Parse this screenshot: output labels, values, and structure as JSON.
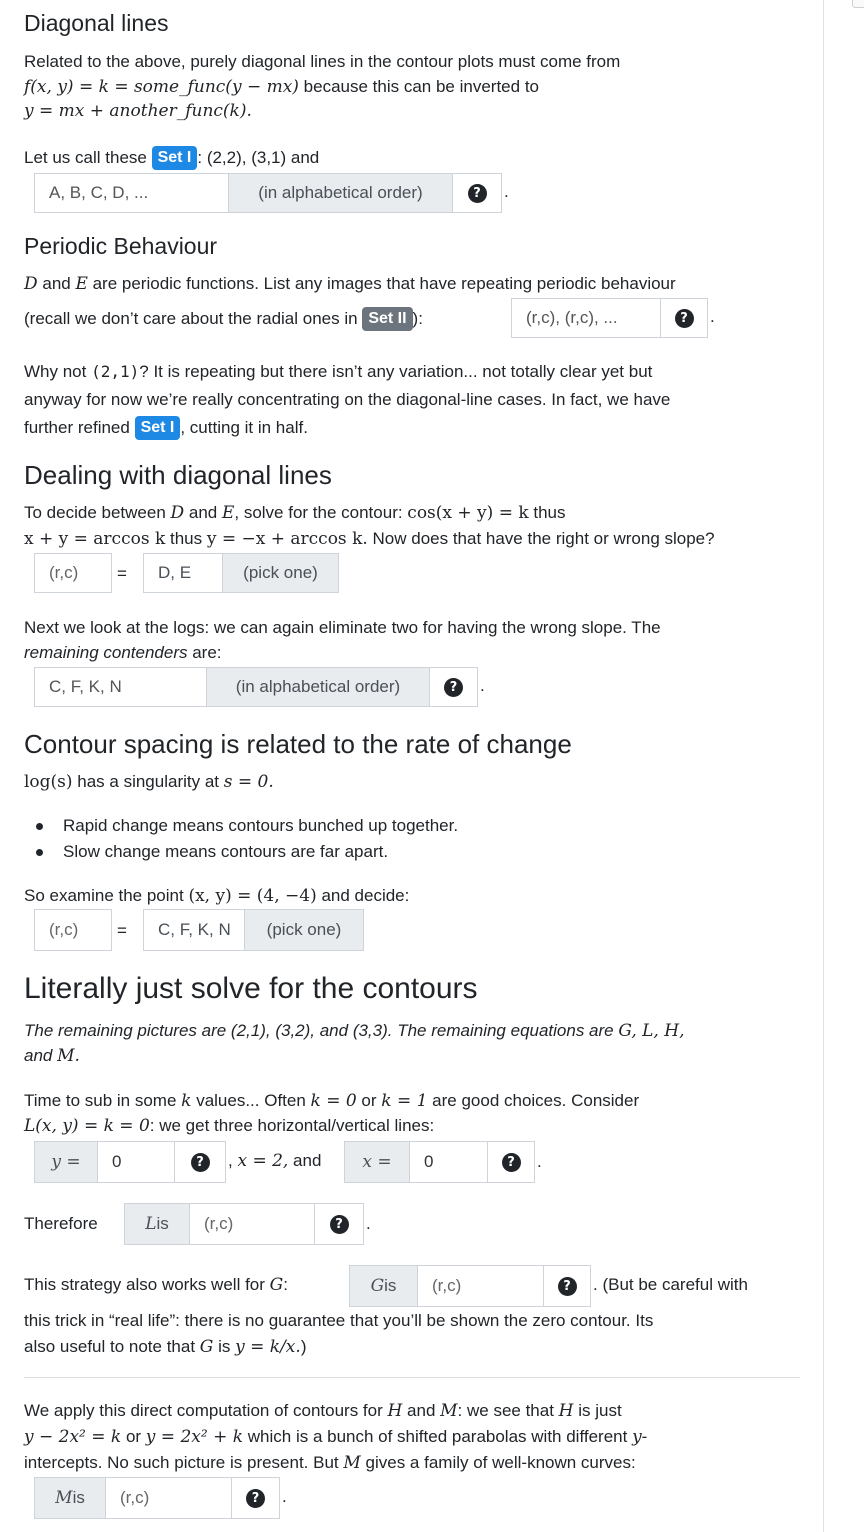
{
  "s1": {
    "title": "Diagonal lines",
    "p1a": "Related to the above, purely diagonal lines in the contour plots must come from",
    "p1b_math": "f(x, y) = k = some_func(y − mx)",
    "p1b_text": " because this can be inverted to",
    "p1c_math": "y = mx + another_func(k).",
    "set1_pre": "Let us call these ",
    "set1_badge": "Set I",
    "set1_post": ": (2,2), (3,1) and",
    "set1_input_placeholder": "A, B, C, D, ...",
    "set1_addon": "(in alphabetical order)",
    "set1_help": "?",
    "set1_tail": "."
  },
  "s2": {
    "title": "Periodic Behaviour",
    "p1_math_d": "D",
    "p1_and": " and ",
    "p1_math_e": "E",
    "p1_rest": " are periodic functions. List any images that have repeating periodic behaviour",
    "p2_pre": "(recall we don’t care about the radial ones in ",
    "p2_badge": "Set II",
    "p2_post": "):",
    "input_placeholder": "(r,c), (r,c), ...",
    "help": "?",
    "tail": ".",
    "why_pre": "Why not ",
    "why_code": "(2,1)",
    "why_post": "? It is repeating but there isn’t any variation... not totally clear yet but",
    "why_line2": "anyway for now we’re really concentrating on the diagonal-line cases. In fact, we have",
    "why_line3_pre": "further refined ",
    "why_badge": "Set I",
    "why_line3_post": ", cutting it in half."
  },
  "s3": {
    "title": "Dealing with diagonal lines",
    "l1_pre": "To decide between ",
    "l1_d": "D",
    "l1_and": " and ",
    "l1_e": "E",
    "l1_mid": ", solve for the contour: ",
    "l1_math": "cos(x + y) = k",
    "l1_thus": " thus",
    "l2_math1": "x + y = arccos k",
    "l2_thus": " thus ",
    "l2_math2": "y = −x + arccos k.",
    "l2_rest": " Now does that have the right or wrong slope?",
    "rc_placeholder": "(r,c)",
    "equals": "=",
    "select_value": "D, E",
    "pick": "(pick one)",
    "logs_line1": "Next we look at the logs: we can again eliminate two for having the wrong slope. The",
    "logs_line2_it": "remaining contenders",
    "logs_line2_rest": " are:",
    "cont_input_placeholder": "C, F, K, N",
    "cont_addon": "(in alphabetical order)",
    "cont_help": "?",
    "cont_tail": "."
  },
  "s4": {
    "title": "Contour spacing is related to the rate of change",
    "l1_math": "log(s)",
    "l1_mid": " has a singularity at ",
    "l1_math2": "s = 0.",
    "bullets": [
      "Rapid change means contours bunched up together.",
      "Slow change means contours are far apart."
    ],
    "exam_pre": "So examine the point ",
    "exam_math": "(x, y) = (4, −4)",
    "exam_post": " and decide:",
    "rc_placeholder": "(r,c)",
    "equals": "=",
    "select_value": "C, F, K, N",
    "pick": "(pick one)"
  },
  "s5": {
    "title": "Literally just solve for the contours",
    "rem_line1_pre": "The remaining pictures are (2,1), (3,2), and (3,3). The remaining equations are ",
    "rem_line1_math": "G, L, H,",
    "rem_line2_pre": "and ",
    "rem_line2_math": "M.",
    "time_pre": "Time to sub in some ",
    "time_k": "k",
    "time_mid": " values... Often ",
    "time_m1": "k = 0",
    "time_or": " or ",
    "time_m2": "k = 1",
    "time_post": " are good choices. Consider",
    "L_math": "L(x, y) = k = 0",
    "L_post": ": we get three horizontal/vertical lines:",
    "y_label": "y =",
    "y_value": "0",
    "help": "?",
    "mid_text_pre": ",",
    "mid_math": "x = 2,",
    "mid_text_post": " and",
    "x_label": "x =",
    "x_value": "0",
    "tail": ".",
    "therefore": "Therefore",
    "L_is_math": "L",
    "L_is_text": " is",
    "rc_placeholder": "(r,c)",
    "G_pre": "This strategy also works well for ",
    "G_math": "G",
    "G_colon": ":",
    "G_is_math": "G",
    "G_is_text": " is",
    "G_post": ". (But be careful with",
    "G_line2": "this trick in “real life”: there is no guarantee that you’ll be shown the zero contour. Its",
    "G_line3_pre": "also useful to note that ",
    "G_line3_math1": "G",
    "G_line3_mid": " is ",
    "G_line3_math2": "y = k/x.",
    "G_line3_post": ")",
    "H_pre": "We apply this direct computation of contours for ",
    "H_math": "H",
    "H_and": " and ",
    "M_math": "M",
    "H_mid": ": we see that ",
    "H_math2": "H",
    "H_post": " is just",
    "H2_math1": "y − 2x² = k",
    "H2_or": " or ",
    "H2_math2": "y = 2x² + k",
    "H2_mid": " which is a bunch of shifted parabolas with different ",
    "H2_math3": "y",
    "H2_dash": "-",
    "H3_pre": "intercepts. No such picture is present. But ",
    "H3_math": "M",
    "H3_post": " gives a family of well-known curves:",
    "M_is_math": "M",
    "M_is_text": " is"
  }
}
